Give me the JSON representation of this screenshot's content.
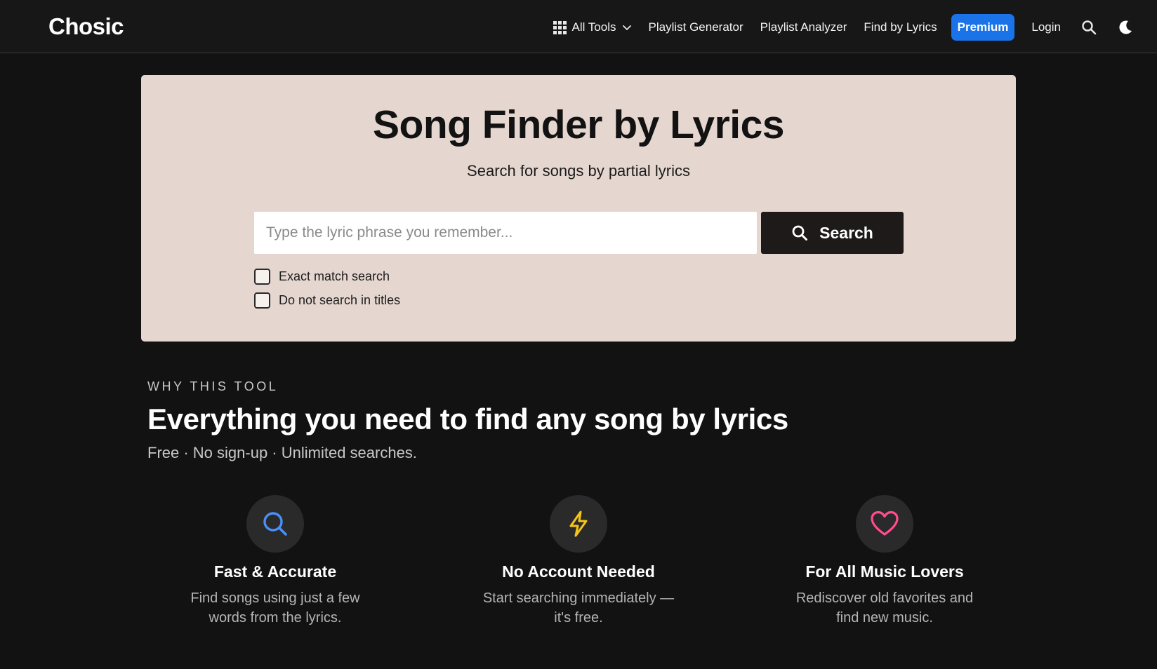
{
  "brand": {
    "name": "Chosic",
    "logo_gradient": [
      "#ff3d7f",
      "#7a3cff",
      "#2f7bff"
    ]
  },
  "nav": {
    "all_tools": "All Tools",
    "playlist_generator": "Playlist Generator",
    "playlist_analyzer": "Playlist Analyzer",
    "find_by_lyrics": "Find by Lyrics",
    "premium": "Premium",
    "login": "Login",
    "icons": [
      "grid-icon",
      "chevron-down-icon",
      "search-icon",
      "moon-icon"
    ]
  },
  "hero": {
    "title": "Song Finder by Lyrics",
    "subtitle": "Search for songs by partial lyrics",
    "search_placeholder": "Type the lyric phrase you remember...",
    "search_value": "",
    "search_button": "Search",
    "options": [
      {
        "label": "Exact match search",
        "checked": false
      },
      {
        "label": "Do not search in titles",
        "checked": false
      }
    ]
  },
  "why": {
    "eyebrow": "WHY THIS TOOL",
    "title": "Everything you need to find any song by lyrics",
    "subtitle": "Free · No sign-up · Unlimited searches.",
    "features": [
      {
        "icon": "search-icon",
        "icon_color": "#4a8ff5",
        "title": "Fast & Accurate",
        "description": "Find songs using just a few words from the lyrics."
      },
      {
        "icon": "lightning-icon",
        "icon_color": "#f5c518",
        "title": "No Account Needed",
        "description": "Start searching immediately — it's free."
      },
      {
        "icon": "heart-icon",
        "icon_color": "#ff4d8d",
        "title": "For All Music Lovers",
        "description": "Rediscover old favorites and find new music."
      }
    ]
  },
  "colors": {
    "page_bg": "#121212",
    "header_bg": "#171717",
    "hero_bg": "#e5d7d0",
    "premium": "#1a73e8",
    "search_button_bg": "#1e1a19"
  }
}
